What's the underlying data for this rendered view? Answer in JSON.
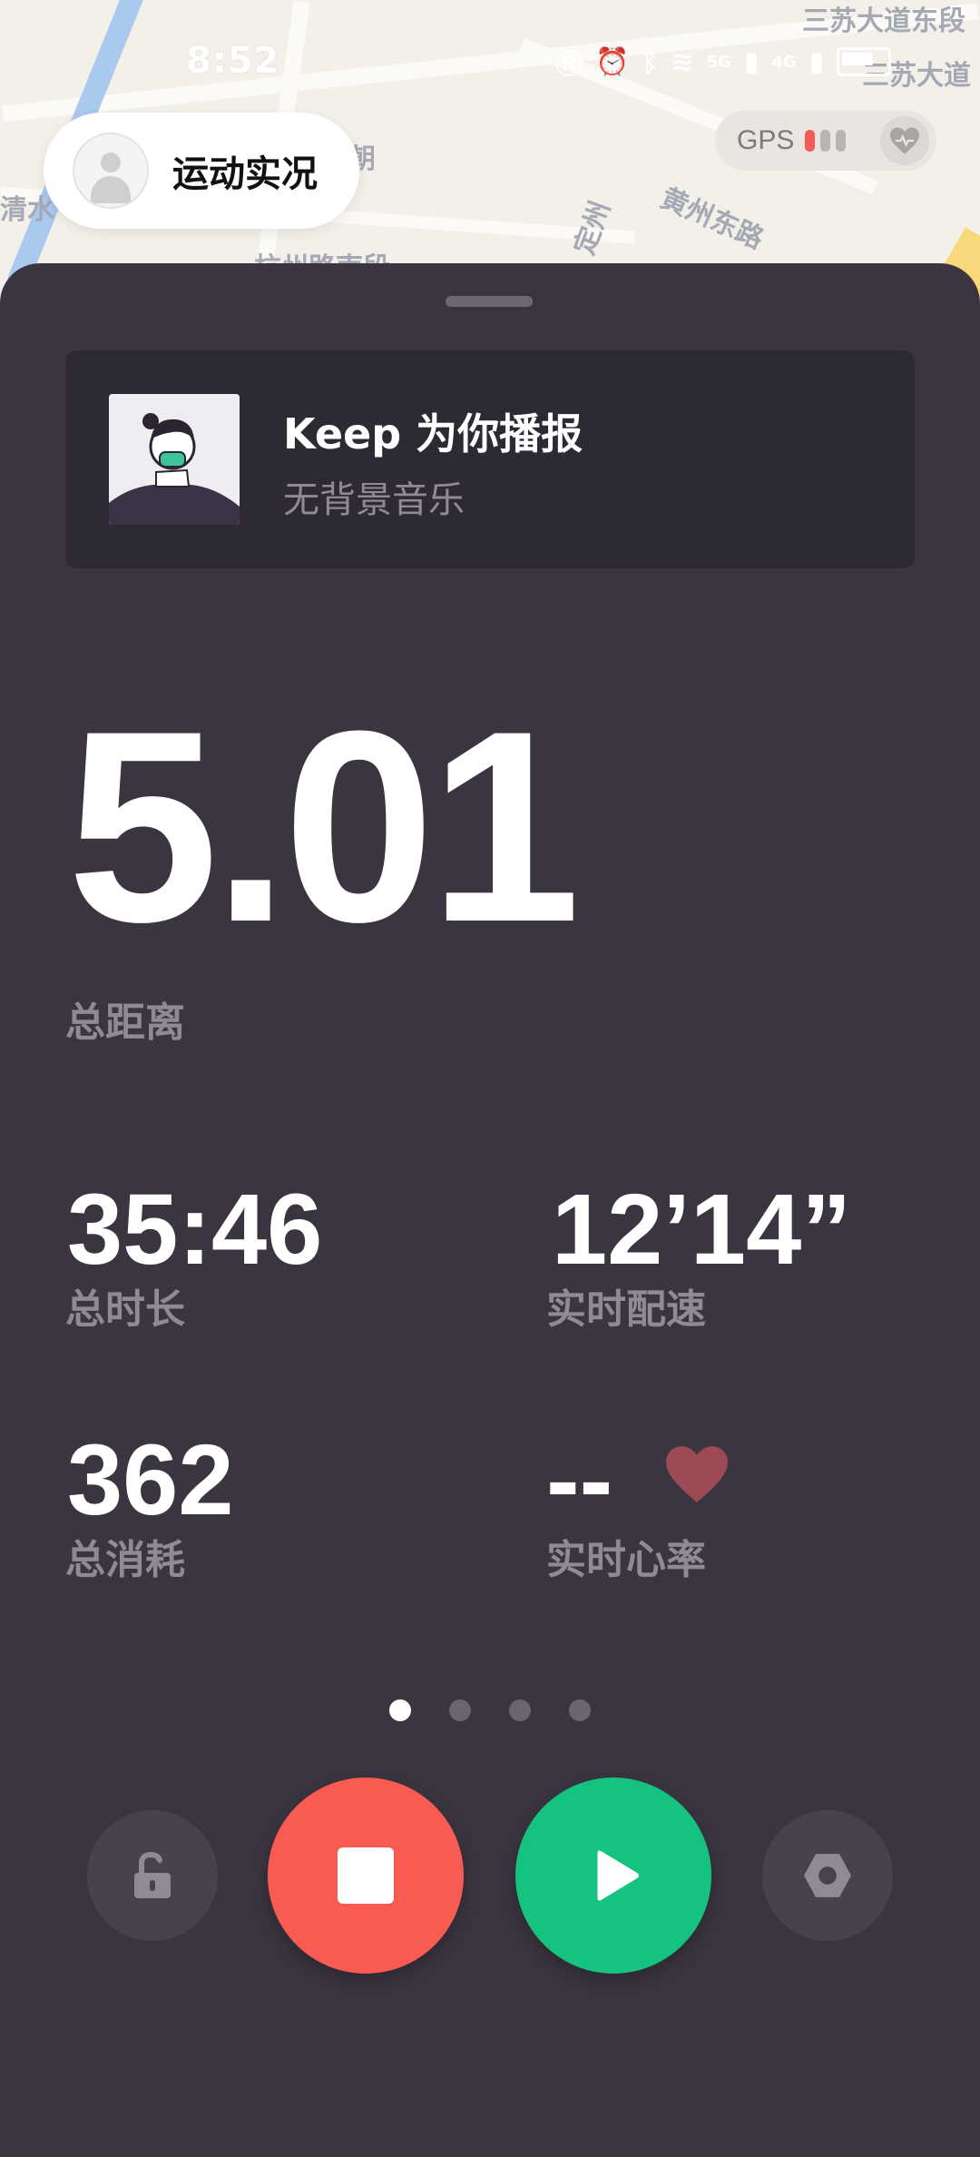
{
  "status_bar": {
    "time": "8:52",
    "icons": [
      "nfc-icon",
      "alarm-icon",
      "bluetooth-icon",
      "wifi-icon",
      "5g-signal-icon",
      "4g-signal-icon",
      "battery-icon"
    ],
    "network_labels": [
      "5G",
      "4G"
    ]
  },
  "map": {
    "labels": [
      "三苏大道东段",
      "三苏大道",
      "朝",
      "清水",
      "杭州路南段",
      "定州",
      "黄州东路"
    ]
  },
  "header": {
    "title": "运动实况",
    "avatar_icon": "user-avatar-icon"
  },
  "gps": {
    "label": "GPS",
    "strength": 1,
    "bars": 3,
    "heart_icon": "heart-rate-icon"
  },
  "music": {
    "title": "Keep 为你播报",
    "subtitle": "无背景音乐"
  },
  "stats": {
    "distance": "5.01",
    "distance_label": "总距离",
    "duration": "35:46",
    "duration_label": "总时长",
    "pace": "12’14”",
    "pace_label": "实时配速",
    "calories": "362",
    "calories_label": "总消耗",
    "heart_rate": "--",
    "heart_rate_label": "实时心率"
  },
  "pager": {
    "count": 4,
    "active": 0
  },
  "controls": {
    "lock": "lock-icon",
    "stop": "stop-icon",
    "resume": "play-icon",
    "settings": "settings-icon"
  },
  "colors": {
    "sheet_bg": "#3a3540",
    "card_bg": "#2e2a33",
    "label_gray": "#8f8a95",
    "stop_red": "#f85b52",
    "play_green": "#16c27f",
    "heart_red": "#9e4a55"
  }
}
